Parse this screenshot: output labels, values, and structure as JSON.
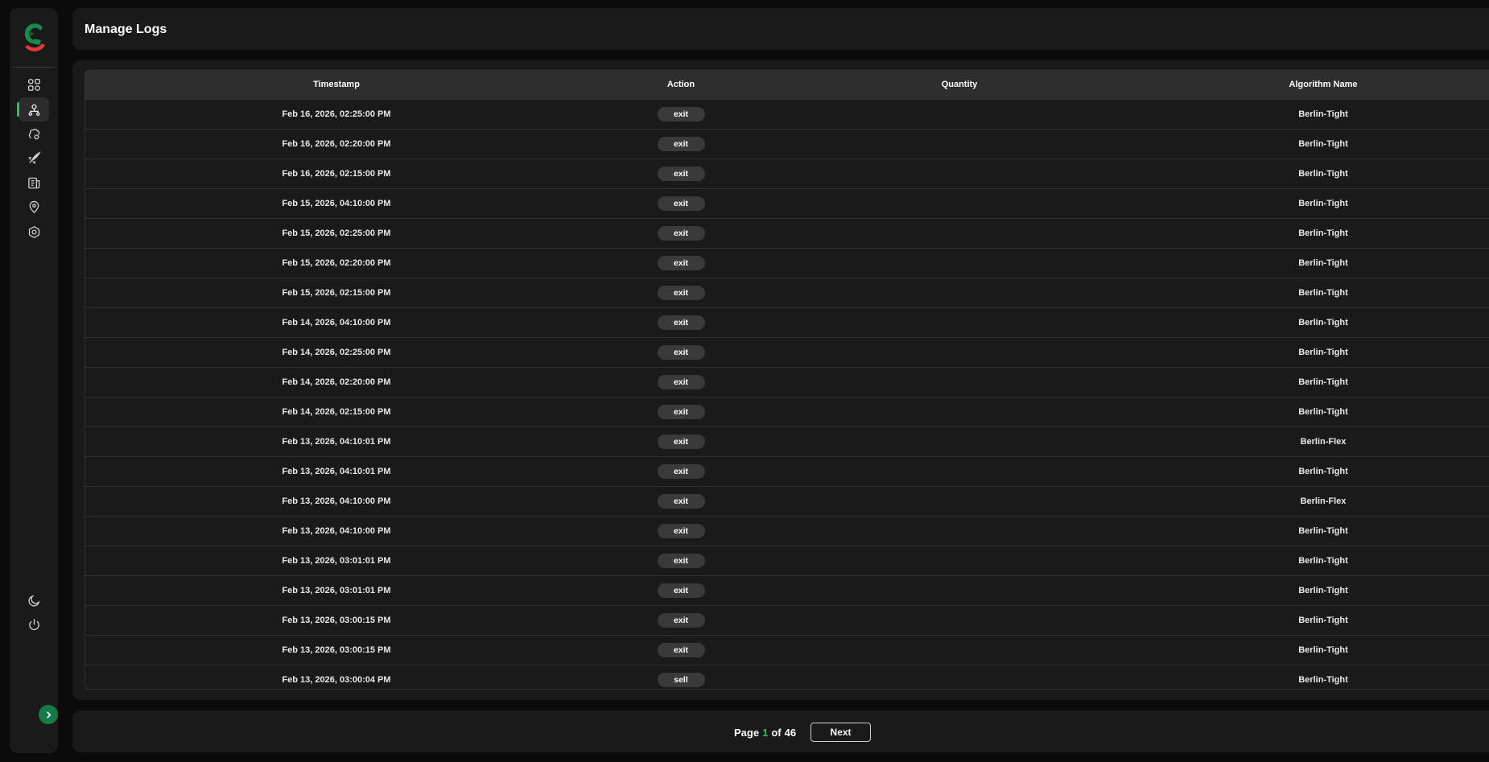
{
  "app": {
    "brand_colors": {
      "accent": "#22c55e",
      "logo_red": "#e53935",
      "logo_green": "#1b8a4a"
    }
  },
  "sidebar": {
    "nav_items": [
      {
        "icon": "dashboard-grid-icon",
        "active": false
      },
      {
        "icon": "network-nodes-icon",
        "active": true
      },
      {
        "icon": "brain-icon",
        "active": false
      },
      {
        "icon": "rocket-icon",
        "active": false
      },
      {
        "icon": "document-icon",
        "active": false
      },
      {
        "icon": "location-pin-icon",
        "active": false
      },
      {
        "icon": "settings-gear-icon",
        "active": false
      }
    ],
    "bottom_items": [
      {
        "icon": "moon-icon"
      },
      {
        "icon": "power-icon"
      },
      {
        "icon": "chevron-right-icon"
      }
    ]
  },
  "header": {
    "title": "Manage Logs"
  },
  "table": {
    "columns": [
      "Timestamp",
      "Action",
      "Quantity",
      "Algorithm Name"
    ],
    "rows": [
      {
        "timestamp": "Feb 16, 2026, 02:25:00 PM",
        "action": "exit",
        "quantity": "",
        "algorithm": "Berlin-Tight"
      },
      {
        "timestamp": "Feb 16, 2026, 02:20:00 PM",
        "action": "exit",
        "quantity": "",
        "algorithm": "Berlin-Tight"
      },
      {
        "timestamp": "Feb 16, 2026, 02:15:00 PM",
        "action": "exit",
        "quantity": "",
        "algorithm": "Berlin-Tight"
      },
      {
        "timestamp": "Feb 15, 2026, 04:10:00 PM",
        "action": "exit",
        "quantity": "",
        "algorithm": "Berlin-Tight"
      },
      {
        "timestamp": "Feb 15, 2026, 02:25:00 PM",
        "action": "exit",
        "quantity": "",
        "algorithm": "Berlin-Tight"
      },
      {
        "timestamp": "Feb 15, 2026, 02:20:00 PM",
        "action": "exit",
        "quantity": "",
        "algorithm": "Berlin-Tight"
      },
      {
        "timestamp": "Feb 15, 2026, 02:15:00 PM",
        "action": "exit",
        "quantity": "",
        "algorithm": "Berlin-Tight"
      },
      {
        "timestamp": "Feb 14, 2026, 04:10:00 PM",
        "action": "exit",
        "quantity": "",
        "algorithm": "Berlin-Tight"
      },
      {
        "timestamp": "Feb 14, 2026, 02:25:00 PM",
        "action": "exit",
        "quantity": "",
        "algorithm": "Berlin-Tight"
      },
      {
        "timestamp": "Feb 14, 2026, 02:20:00 PM",
        "action": "exit",
        "quantity": "",
        "algorithm": "Berlin-Tight"
      },
      {
        "timestamp": "Feb 14, 2026, 02:15:00 PM",
        "action": "exit",
        "quantity": "",
        "algorithm": "Berlin-Tight"
      },
      {
        "timestamp": "Feb 13, 2026, 04:10:01 PM",
        "action": "exit",
        "quantity": "",
        "algorithm": "Berlin-Flex"
      },
      {
        "timestamp": "Feb 13, 2026, 04:10:01 PM",
        "action": "exit",
        "quantity": "",
        "algorithm": "Berlin-Tight"
      },
      {
        "timestamp": "Feb 13, 2026, 04:10:00 PM",
        "action": "exit",
        "quantity": "",
        "algorithm": "Berlin-Flex"
      },
      {
        "timestamp": "Feb 13, 2026, 04:10:00 PM",
        "action": "exit",
        "quantity": "",
        "algorithm": "Berlin-Tight"
      },
      {
        "timestamp": "Feb 13, 2026, 03:01:01 PM",
        "action": "exit",
        "quantity": "",
        "algorithm": "Berlin-Tight"
      },
      {
        "timestamp": "Feb 13, 2026, 03:01:01 PM",
        "action": "exit",
        "quantity": "",
        "algorithm": "Berlin-Tight"
      },
      {
        "timestamp": "Feb 13, 2026, 03:00:15 PM",
        "action": "exit",
        "quantity": "",
        "algorithm": "Berlin-Tight"
      },
      {
        "timestamp": "Feb 13, 2026, 03:00:15 PM",
        "action": "exit",
        "quantity": "",
        "algorithm": "Berlin-Tight"
      },
      {
        "timestamp": "Feb 13, 2026, 03:00:04 PM",
        "action": "sell",
        "quantity": "",
        "algorithm": "Berlin-Tight"
      }
    ]
  },
  "pagination": {
    "page_label": "Page",
    "current_page": "1",
    "of_label": "of",
    "total_pages": "46",
    "next_label": "Next"
  }
}
